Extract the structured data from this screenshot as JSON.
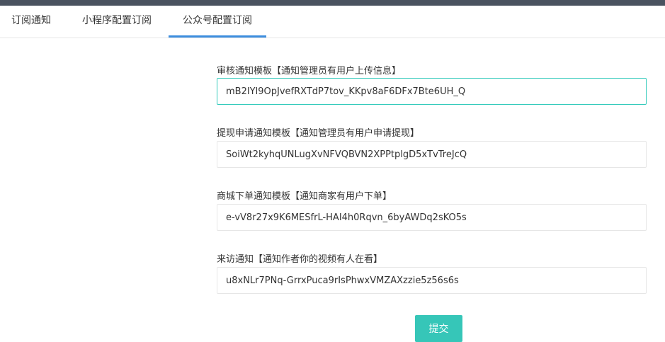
{
  "tabs": [
    {
      "label": "订阅通知",
      "active": false
    },
    {
      "label": "小程序配置订阅",
      "active": false
    },
    {
      "label": "公众号配置订阅",
      "active": true
    }
  ],
  "fields": [
    {
      "label": "审核通知模板【通知管理员有用户上传信息】",
      "value": "mB2IYl9OpJvefRXTdP7tov_KKpv8aF6DFx7Bte6UH_Q",
      "focused": true
    },
    {
      "label": "提现申请通知模板【通知管理员有用户申请提现】",
      "value": "SoiWt2kyhqUNLugXvNFVQBVN2XPPtplgD5xTvTreJcQ",
      "focused": false
    },
    {
      "label": "商城下单通知模板【通知商家有用户下单】",
      "value": "e-vV8r27x9K6MESfrL-HAI4h0Rqvn_6byAWDq2sKO5s",
      "focused": false
    },
    {
      "label": "来访通知【通知作者你的视频有人在看】",
      "value": "u8xNLr7PNq-GrrxPuca9rIsPhwxVMZAXzzie5z56s6s",
      "focused": false
    }
  ],
  "submit_label": "提交",
  "colors": {
    "topbar": "#4a5360",
    "active_tab_underline": "#3c8dde",
    "focus_border": "#33cabb",
    "submit_bg": "#36c6b8"
  }
}
